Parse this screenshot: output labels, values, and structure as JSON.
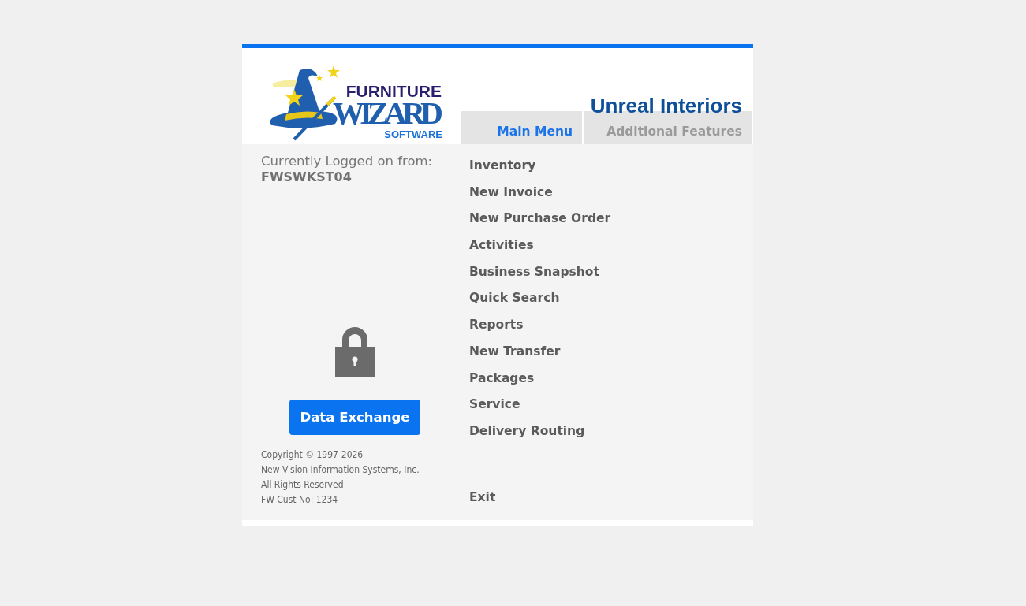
{
  "logo": {
    "line_1": "FURNITURE",
    "line_2": "WIZARD",
    "line_3": "SOFTWARE"
  },
  "company": "Unreal Interiors",
  "tabs": [
    {
      "label": "Main Menu",
      "selected": true
    },
    {
      "label": "Additional Features",
      "selected": false
    }
  ],
  "login": {
    "label": "Currently Logged on from:",
    "workstation": "FWSWKST04"
  },
  "data_exchange_button": "Data Exchange",
  "footer": [
    "Copyright © 1997-2026",
    "New Vision Information Systems, Inc.",
    "All Rights Reserved",
    "FW Cust No: 1234"
  ],
  "menu": [
    {
      "label": "Inventory"
    },
    {
      "label": "New Invoice"
    },
    {
      "label": "New Purchase Order"
    },
    {
      "label": "Activities"
    },
    {
      "label": "Business Snapshot"
    },
    {
      "label": "Quick Search"
    },
    {
      "label": "Reports"
    },
    {
      "label": "New Transfer"
    },
    {
      "label": "Packages"
    },
    {
      "label": "Service"
    },
    {
      "label": "Delivery Routing"
    }
  ],
  "exit": "Exit"
}
